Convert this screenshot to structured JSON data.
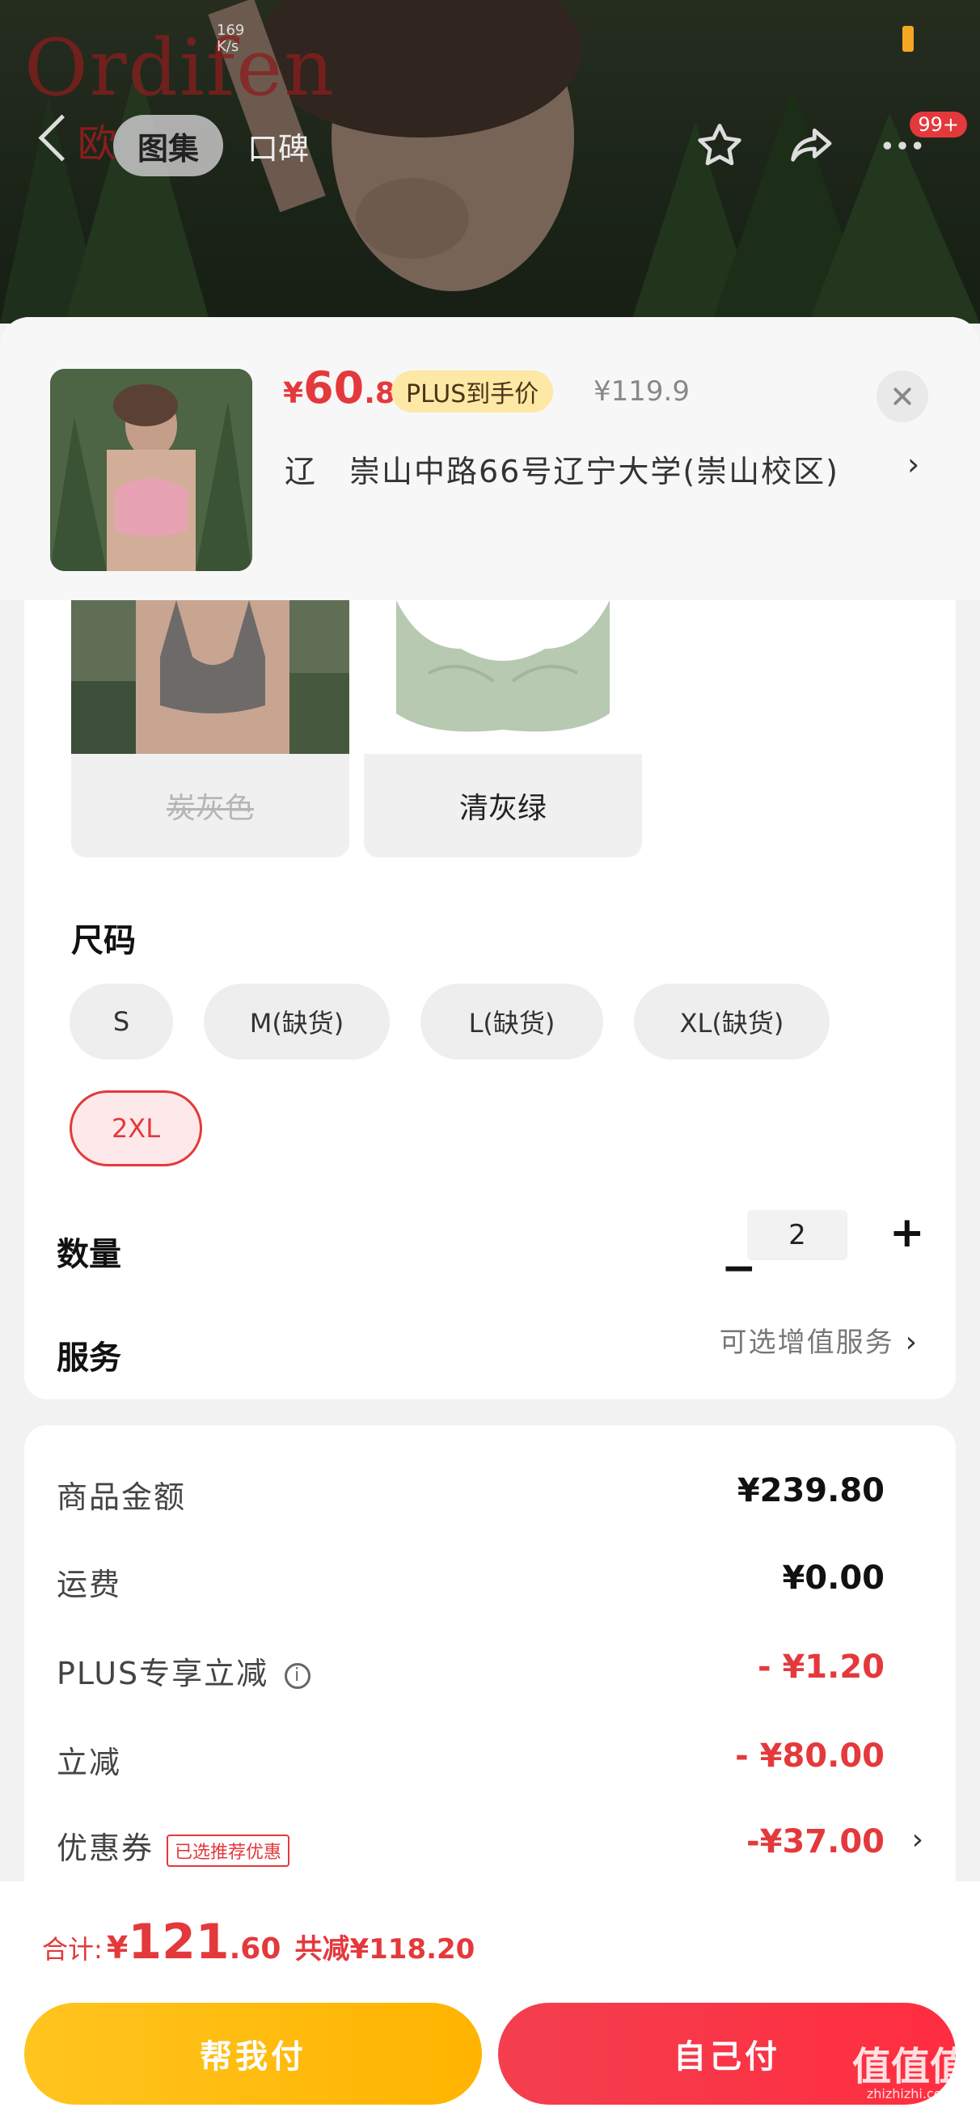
{
  "status_bar": {
    "left_text": "",
    "speed_value": "169",
    "speed_unit": "K/s",
    "right_text": ""
  },
  "hero": {
    "brand_logo_text": "Ordifen",
    "brand_mini": "欧",
    "tabs": [
      {
        "label": "图集",
        "selected": true
      },
      {
        "label": "口碑",
        "selected": false
      }
    ],
    "badge": "99+",
    "icons": [
      "back-icon",
      "star-icon",
      "share-icon",
      "more-icon"
    ]
  },
  "sku_header": {
    "price_symbol": "¥",
    "price_int": "60",
    "price_dec": ".8",
    "plus_tag": "PLUS到手价",
    "original_price": "¥119.9",
    "address": "辽　崇山中路66号辽宁大学(崇山校区)",
    "address_chevron": "›"
  },
  "colors": [
    {
      "label": "炭灰色",
      "disabled": true
    },
    {
      "label": "清灰绿",
      "disabled": false
    }
  ],
  "size": {
    "title": "尺码",
    "options": [
      {
        "label": "S",
        "selected": false
      },
      {
        "label": "M(缺货)",
        "selected": false
      },
      {
        "label": "L(缺货)",
        "selected": false
      },
      {
        "label": "XL(缺货)",
        "selected": false
      },
      {
        "label": "2XL",
        "selected": true
      }
    ]
  },
  "quantity": {
    "title": "数量",
    "minus": "−",
    "value": "2",
    "plus": "+"
  },
  "service": {
    "title": "服务",
    "hint": "可选增值服务",
    "chevron": "›"
  },
  "summary": {
    "rows": [
      {
        "label": "商品金额",
        "value": "¥239.80",
        "red": false
      },
      {
        "label": "运费",
        "value": "¥0.00",
        "red": false
      },
      {
        "label": "PLUS专享立减",
        "value": "- ¥1.20",
        "red": true,
        "info_icon": "i"
      },
      {
        "label": "立减",
        "value": "- ¥80.00",
        "red": true
      },
      {
        "label": "优惠券",
        "value": "-¥37.00",
        "red": true,
        "tag": "已选推荐优惠",
        "chevron": "›"
      }
    ]
  },
  "footer": {
    "total_label": "合计:",
    "total_symbol": "¥",
    "total_int": "121",
    "total_dec": ".60",
    "saved_text": "共减¥118.20",
    "btn_help": "帮我付",
    "btn_self": "自己付"
  },
  "watermark": {
    "mark": "值值值",
    "site": "zhizhizhi.com"
  },
  "colors_theme": {
    "accent_red": "#e4393c",
    "help_button": "#ffb400",
    "self_button": "#f33f4f",
    "plus_tag_bg": "#fde8a6"
  }
}
